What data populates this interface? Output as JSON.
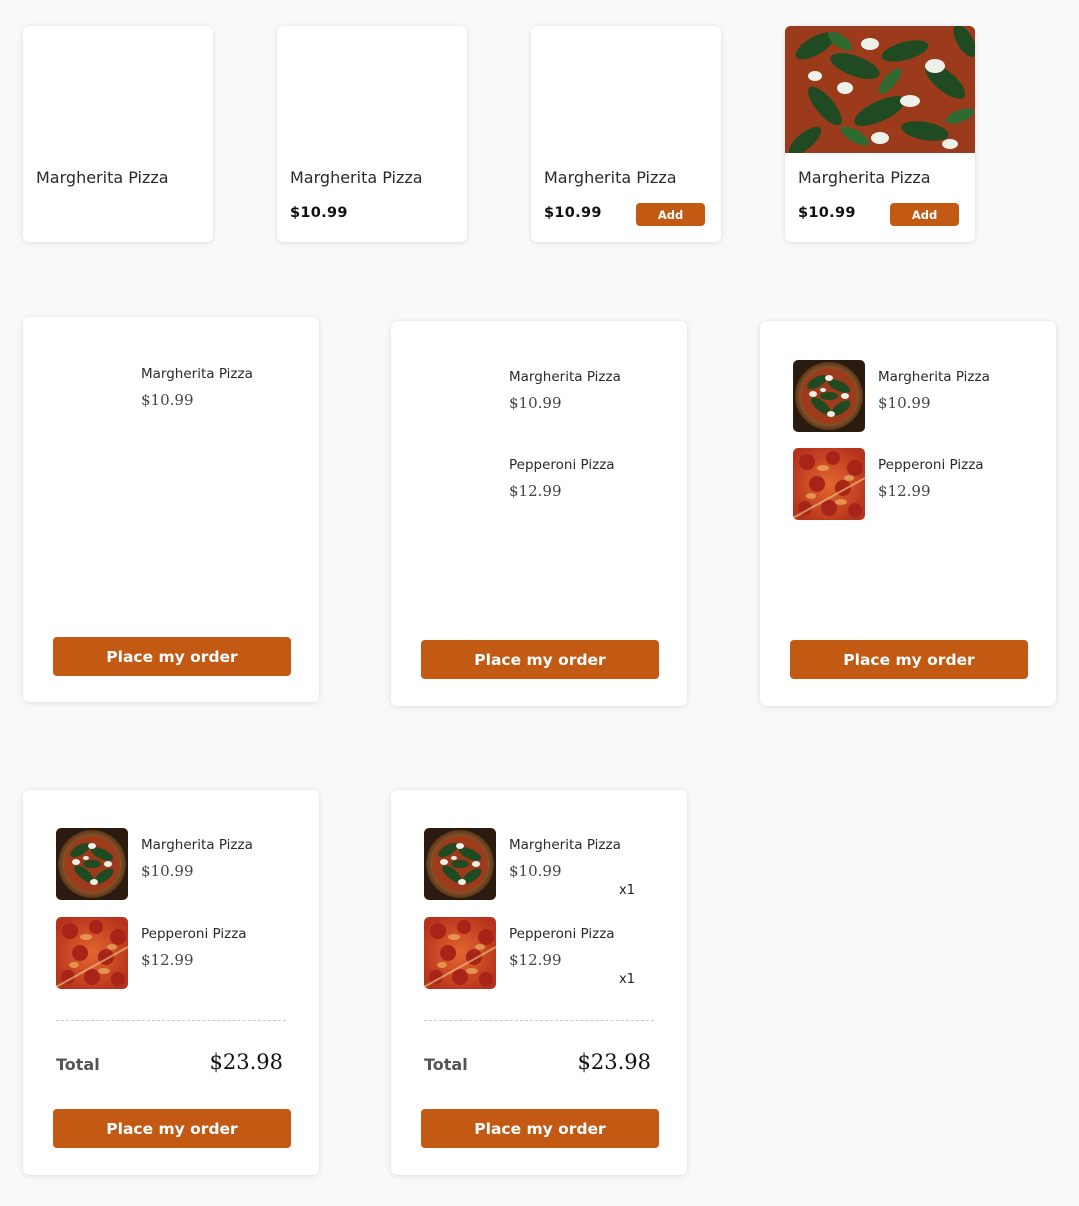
{
  "colors": {
    "accent": "#c25a14",
    "background": "#f9f9f9",
    "card": "#ffffff"
  },
  "products": [
    {
      "name": "Margherita Pizza",
      "price": "",
      "add_label": ""
    },
    {
      "name": "Margherita Pizza",
      "price": "$10.99",
      "add_label": ""
    },
    {
      "name": "Margherita Pizza",
      "price": "$10.99",
      "add_label": "Add"
    },
    {
      "name": "Margherita Pizza",
      "price": "$10.99",
      "add_label": "Add",
      "image": "margherita-pizza-photo"
    }
  ],
  "carts": [
    {
      "items": [
        {
          "name": "Margherita Pizza",
          "price": "$10.99"
        }
      ],
      "order_label": "Place my order"
    },
    {
      "items": [
        {
          "name": "Margherita Pizza",
          "price": "$10.99"
        },
        {
          "name": "Pepperoni Pizza",
          "price": "$12.99"
        }
      ],
      "order_label": "Place my order"
    },
    {
      "items": [
        {
          "name": "Margherita Pizza",
          "price": "$10.99",
          "image": "margherita-pizza-photo"
        },
        {
          "name": "Pepperoni Pizza",
          "price": "$12.99",
          "image": "pepperoni-pizza-photo"
        }
      ],
      "order_label": "Place my order"
    },
    {
      "items": [
        {
          "name": "Margherita Pizza",
          "price": "$10.99",
          "image": "margherita-pizza-photo"
        },
        {
          "name": "Pepperoni Pizza",
          "price": "$12.99",
          "image": "pepperoni-pizza-photo"
        }
      ],
      "total_label": "Total",
      "total_value": "$23.98",
      "order_label": "Place my order"
    },
    {
      "items": [
        {
          "name": "Margherita Pizza",
          "price": "$10.99",
          "qty": "x1",
          "image": "margherita-pizza-photo"
        },
        {
          "name": "Pepperoni Pizza",
          "price": "$12.99",
          "qty": "x1",
          "image": "pepperoni-pizza-photo"
        }
      ],
      "total_label": "Total",
      "total_value": "$23.98",
      "order_label": "Place my order"
    }
  ]
}
